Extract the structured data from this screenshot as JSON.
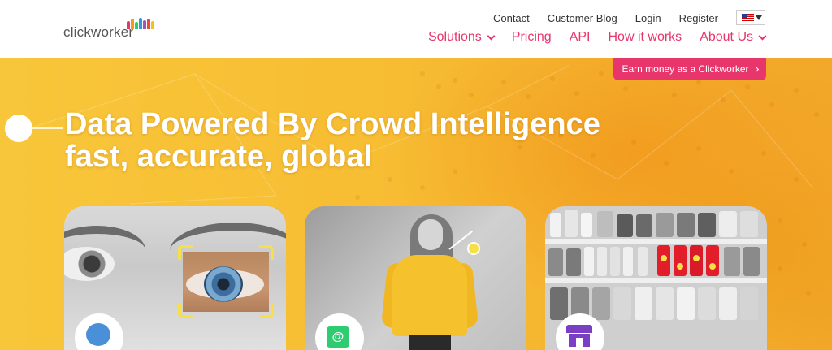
{
  "header": {
    "logo_text": "clickworker",
    "top_links": [
      "Contact",
      "Customer Blog",
      "Login",
      "Register"
    ],
    "language": {
      "icon": "us-flag-icon"
    },
    "main_nav": [
      {
        "label": "Solutions",
        "has_dropdown": true
      },
      {
        "label": "Pricing",
        "has_dropdown": false
      },
      {
        "label": "API",
        "has_dropdown": false
      },
      {
        "label": "How it works",
        "has_dropdown": false
      },
      {
        "label": "About Us",
        "has_dropdown": true
      }
    ]
  },
  "hero": {
    "earn_button": "Earn money as a Clickworker",
    "title_line1": "Data Powered By Crowd Intelligence",
    "title_line2": "fast, accurate, global"
  },
  "cards": [
    {
      "name": "eye",
      "icon": "brain-icon"
    },
    {
      "name": "woman",
      "icon": "shopping-bag-icon"
    },
    {
      "name": "supermarket-shelf",
      "icon": "store-icon"
    }
  ],
  "colors": {
    "accent": "#e8366d",
    "hero_yellow": "#f7bd33",
    "highlight_yellow": "#f6e04a"
  }
}
